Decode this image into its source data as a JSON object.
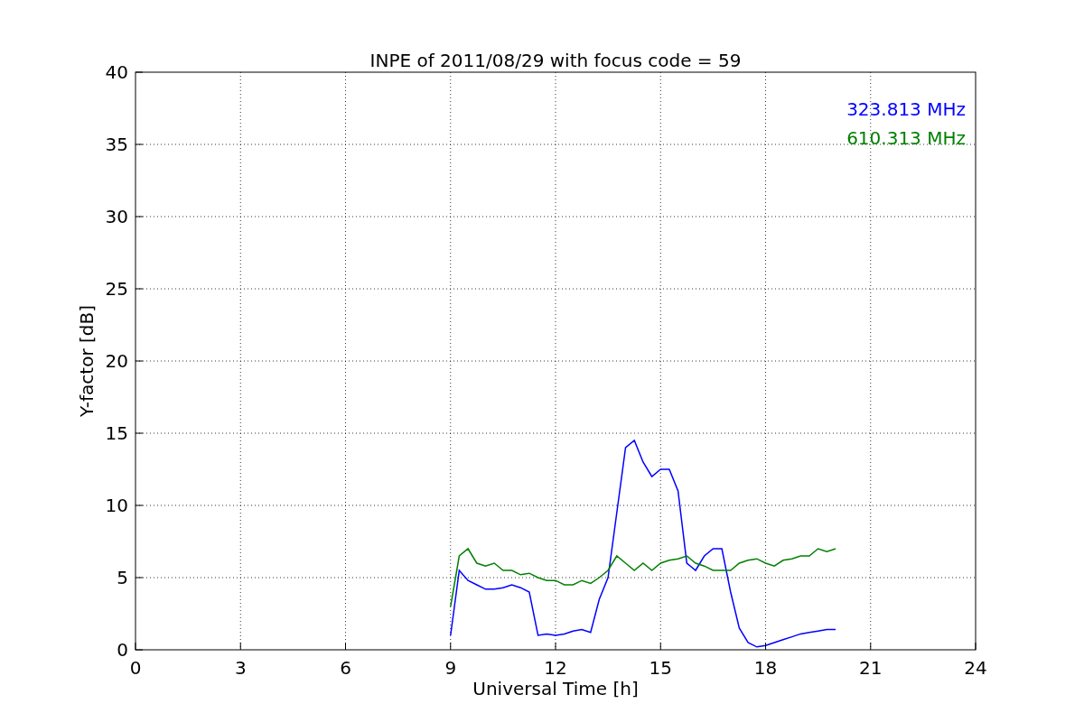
{
  "figure": {
    "chart_data": {
      "type": "line",
      "title": "INPE of 2011/08/29 with focus code = 59",
      "xlabel": "Universal Time [h]",
      "ylabel": "Y-factor [dB]",
      "x": [
        9,
        9.25,
        9.5,
        9.75,
        10,
        10.25,
        10.5,
        10.75,
        11,
        11.25,
        11.5,
        11.75,
        12,
        12.25,
        12.5,
        12.75,
        13,
        13.25,
        13.5,
        13.75,
        14,
        14.25,
        14.5,
        14.75,
        15,
        15.25,
        15.5,
        15.75,
        16,
        16.25,
        16.5,
        16.75,
        17,
        17.25,
        17.5,
        17.75,
        18,
        18.25,
        18.5,
        18.75,
        19,
        19.25,
        19.5,
        19.75,
        20
      ],
      "series": [
        {
          "name": "323.813 MHz",
          "color": "#0000ff",
          "values": [
            1,
            5.5,
            4.8,
            4.5,
            4.2,
            4.2,
            4.3,
            4.5,
            4.3,
            4,
            1,
            1.1,
            1,
            1.1,
            1.3,
            1.4,
            1.2,
            3.5,
            5,
            9.5,
            14,
            14.5,
            13,
            12,
            12.5,
            12.5,
            11,
            6,
            5.5,
            6.5,
            7,
            7,
            4,
            1.5,
            0.5,
            0.2,
            0.3,
            0.5,
            0.7,
            0.9,
            1.1,
            1.2,
            1.3,
            1.4,
            1.4
          ]
        },
        {
          "name": "610.313 MHz",
          "color": "#008000",
          "values": [
            3,
            6.5,
            7,
            6,
            5.8,
            6,
            5.5,
            5.5,
            5.2,
            5.3,
            5,
            4.8,
            4.8,
            4.5,
            4.5,
            4.8,
            4.6,
            5,
            5.5,
            6.5,
            6,
            5.5,
            6,
            5.5,
            6,
            6.2,
            6.3,
            6.5,
            6,
            5.8,
            5.5,
            5.5,
            5.5,
            6,
            6.2,
            6.3,
            6,
            5.8,
            6.2,
            6.3,
            6.5,
            6.5,
            7,
            6.8,
            7
          ]
        }
      ],
      "xlim": [
        0,
        24
      ],
      "ylim": [
        0,
        40
      ],
      "xticks": [
        0,
        3,
        6,
        9,
        12,
        15,
        18,
        21,
        24
      ],
      "yticks": [
        0,
        5,
        10,
        15,
        20,
        25,
        30,
        35,
        40
      ],
      "grid": true
    }
  }
}
